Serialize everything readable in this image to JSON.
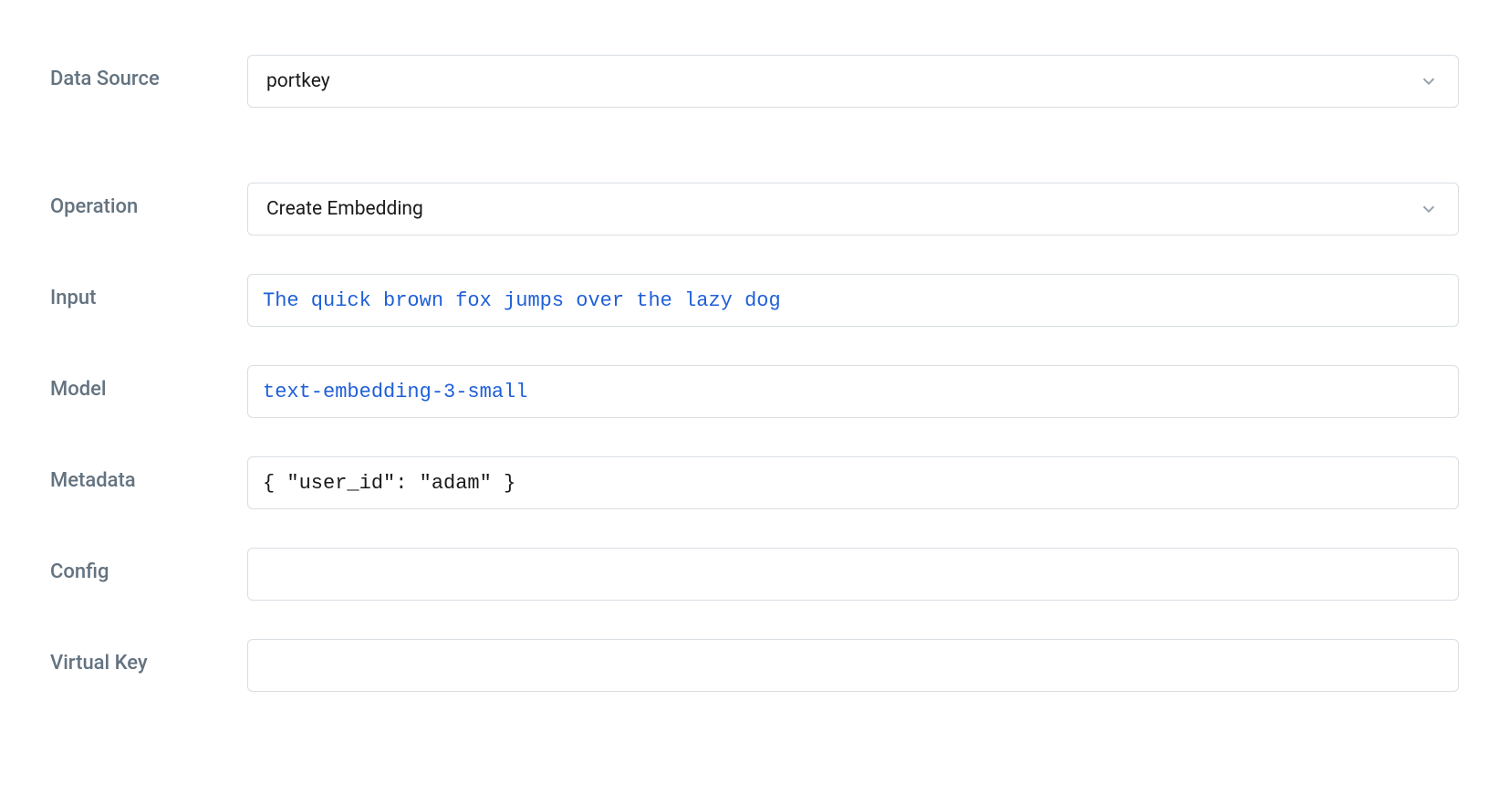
{
  "form": {
    "dataSource": {
      "label": "Data Source",
      "value": "portkey"
    },
    "operation": {
      "label": "Operation",
      "value": "Create Embedding"
    },
    "input": {
      "label": "Input",
      "value": "The quick brown fox jumps over the lazy dog"
    },
    "model": {
      "label": "Model",
      "value": "text-embedding-3-small"
    },
    "metadata": {
      "label": "Metadata",
      "value": "{ \"user_id\": \"adam\" }"
    },
    "config": {
      "label": "Config",
      "value": ""
    },
    "virtualKey": {
      "label": "Virtual Key",
      "value": ""
    }
  }
}
